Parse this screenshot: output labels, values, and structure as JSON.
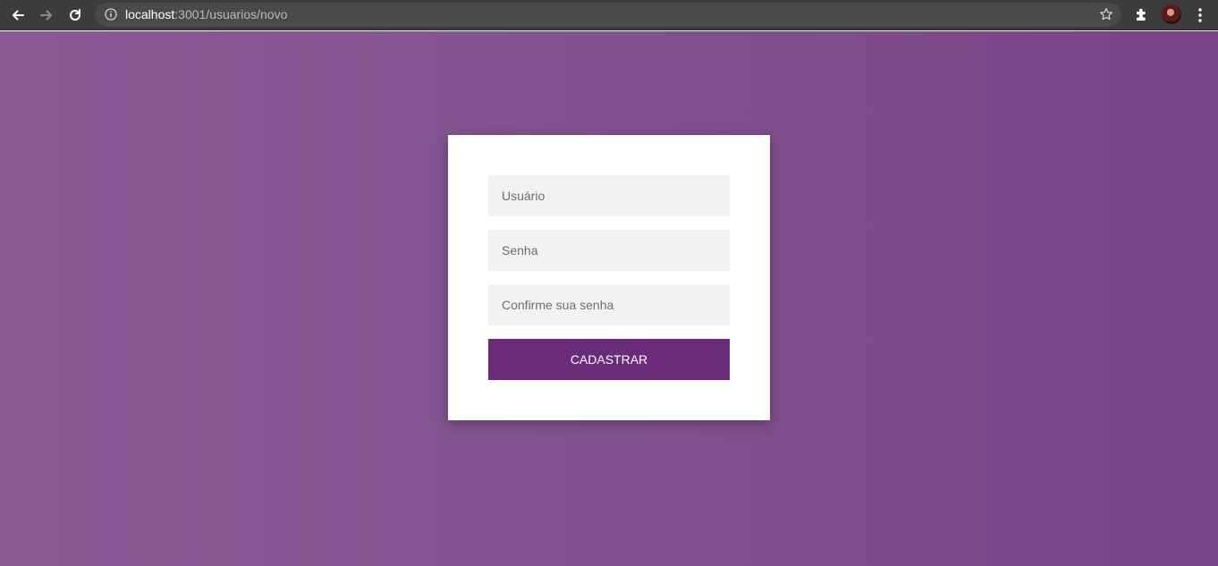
{
  "browser": {
    "url_host": "localhost",
    "url_path": ":3001/usuarios/novo"
  },
  "form": {
    "username_placeholder": "Usuário",
    "password_placeholder": "Senha",
    "confirm_placeholder": "Confirme sua senha",
    "submit_label": "CADASTRAR"
  },
  "colors": {
    "background": "#83548f",
    "button": "#6a2c78",
    "field": "#f2f2f2"
  },
  "icons": [
    "back-icon",
    "forward-icon",
    "reload-icon",
    "info-icon",
    "star-icon",
    "extensions-icon",
    "menu-icon"
  ]
}
